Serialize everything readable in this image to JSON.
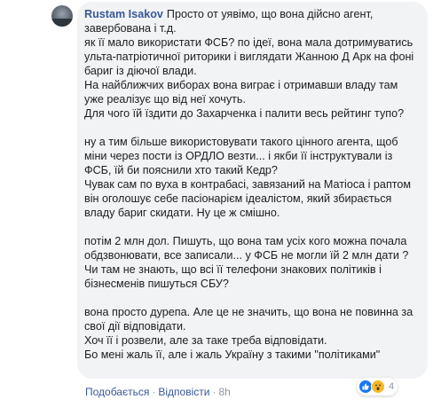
{
  "comment": {
    "author": "Rustam Isakov",
    "paragraphs": [
      "Просто от уявімо, що вона дійсно агент, завербована і т.д.\nяк її мало використати ФСБ? по ідеї, вона мала дотримуватись ульта-патріотичної риторики і виглядати Жанною Д Арк на фоні бариг із діючої влади.\nНа найближчих виборах вона виграє і отримавши владу там уже реалізує що від неї хочуть.\nДля чого їй їздити до Захарченка і палити весь рейтинг тупо?",
      "ну а тим більше використовувати такого цінного агента, щоб міни через пости із ОРДЛО везти... і якби її інструктували із ФСБ, їй би пояснили хто такий Кедр?\nЧувак сам по вуха в контрабасі, завязаний на Матіоса і раптом він оголошує себе пасіонарієм ідеалістом, який збирається владу бариг скидати. Ну це ж смішно.",
      "потім 2 млн дол. Пишуть, що вона там усіх кого можна почала обдзвонювати, все записали... у ФСБ не могли їй 2 млн дати ? Чи там не знають, що всі її телефони знакових політиків і бізнесменів пишуться СБУ?",
      "вона просто дурепа. Але це не значить, що вона не повинна за свої дії відповідати.\nХоч її і розвели, але за таке треба відповідати.\nБо мені жаль її, але і жаль Україну з такими \"політиками\""
    ]
  },
  "actions": {
    "like_label": "Подобається",
    "reply_label": "Відповісти",
    "separator": "·",
    "time": "8h"
  },
  "reactions": {
    "icons": [
      "like-icon",
      "wow-icon"
    ],
    "count": "4",
    "colors": {
      "like": "#1877f2",
      "wow": "#f7b928"
    }
  }
}
